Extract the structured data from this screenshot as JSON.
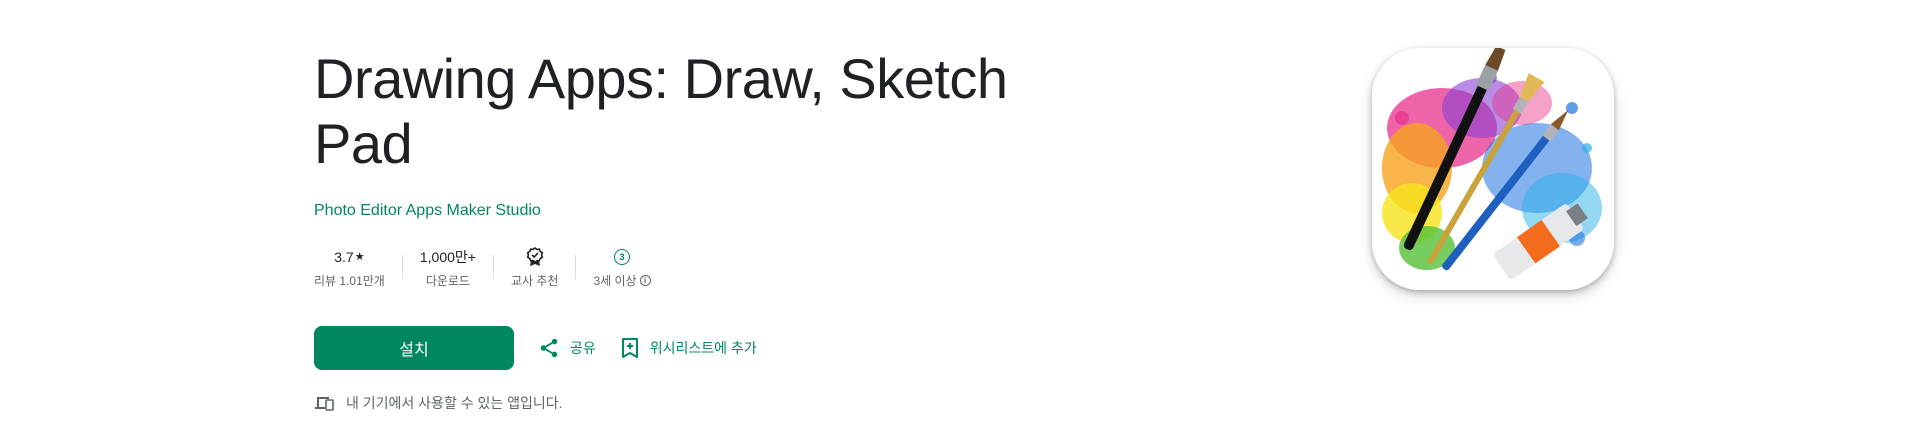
{
  "app": {
    "title": "Drawing Apps: Draw, Sketch Pad",
    "developer": "Photo Editor Apps Maker Studio",
    "icon": "paint-brushes-splash-icon"
  },
  "stats": {
    "rating": {
      "value": "3.7",
      "star": "★",
      "label": "리뷰 1.01만개"
    },
    "downloads": {
      "value": "1,000만+",
      "label": "다운로드"
    },
    "teacher": {
      "icon": "teacher-approved-badge-icon",
      "label": "교사 추천"
    },
    "age": {
      "badge": "3",
      "label": "3세 이상",
      "info_icon": "info-icon"
    }
  },
  "actions": {
    "install_label": "설치",
    "share_label": "공유",
    "wishlist_label": "위시리스트에 추가"
  },
  "device_note": {
    "icon": "devices-icon",
    "text": "내 기기에서 사용할 수 있는 앱입니다."
  },
  "colors": {
    "accent": "#01875f",
    "text_primary": "#202124",
    "text_secondary": "#5f6368"
  }
}
